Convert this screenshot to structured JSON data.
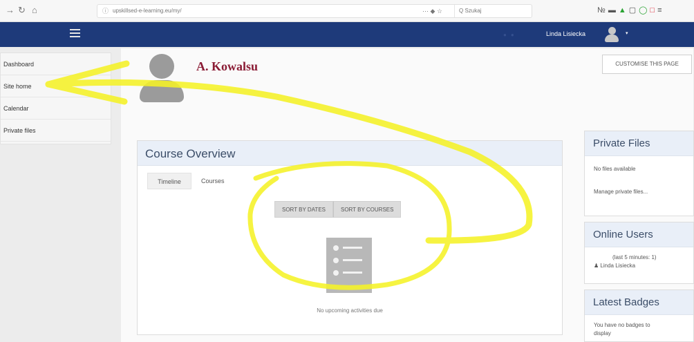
{
  "browser": {
    "back": "→",
    "reload": "↻",
    "home": "⌂",
    "info": "ⓘ",
    "url": "upskillsed-e-learning.eu/my/",
    "page_actions": "··· ◆ ☆",
    "search_placeholder": "Q Szukaj"
  },
  "navbar": {
    "bg_color": "#1e3a7a",
    "user_name": "Linda Lisiecka",
    "caret": "▾"
  },
  "drawer": {
    "items": [
      {
        "label": "Dashboard"
      },
      {
        "label": "Site home"
      },
      {
        "label": "Calendar"
      },
      {
        "label": "Private files"
      }
    ]
  },
  "profile": {
    "name": "A. Kowalsu",
    "customise_label": "CUSTOMISE THIS PAGE"
  },
  "course_overview": {
    "title": "Course Overview",
    "tabs": [
      {
        "label": "Timeline",
        "active": true
      },
      {
        "label": "Courses",
        "active": false
      }
    ],
    "sort_dates": "SORT BY DATES",
    "sort_courses": "SORT BY COURSES",
    "empty_text": "No upcoming activities due"
  },
  "private_files": {
    "title": "Private Files",
    "empty": "No files available",
    "manage_link": "Manage private files..."
  },
  "online_users": {
    "title": "Online Users",
    "period": "(last 5 minutes: 1)",
    "user": "Linda Lisiecka"
  },
  "latest_badges": {
    "title": "Latest Badges",
    "empty": "You have no badges to display"
  },
  "annotation": {
    "color": "#f5f227"
  }
}
